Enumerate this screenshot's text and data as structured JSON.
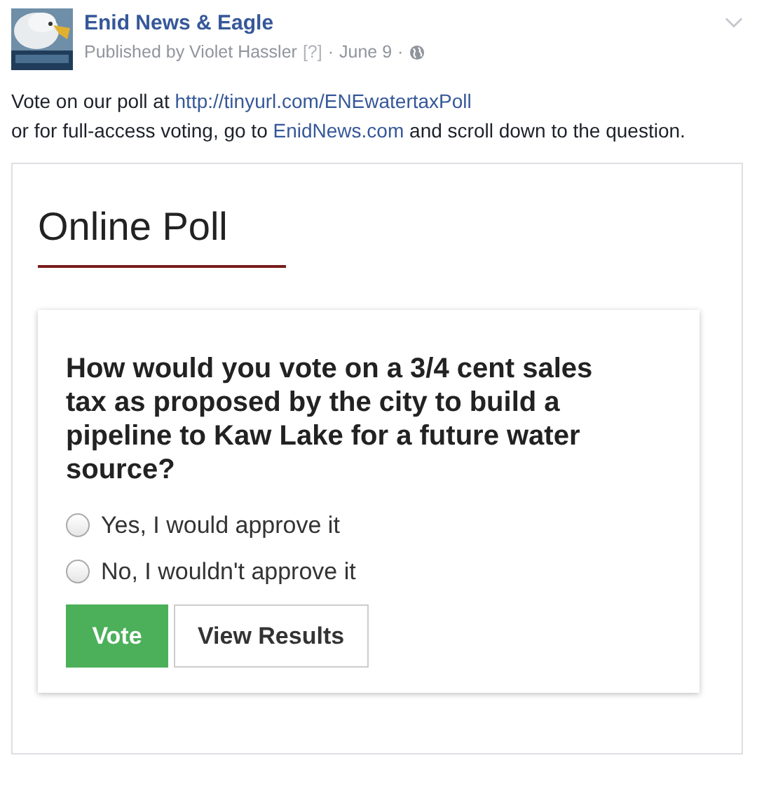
{
  "post": {
    "page_name": "Enid News & Eagle",
    "published_by": "Published by Violet Hassler",
    "help_mark": "[?]",
    "separator_1": "·",
    "date": "June 9",
    "separator_2": "·",
    "body_lines": [
      [
        {
          "kind": "text",
          "text": "Vote on our poll at "
        },
        {
          "kind": "link",
          "text": "http://tinyurl.com/ENEwatertaxPoll"
        }
      ],
      [
        {
          "kind": "text",
          "text": "or for full-access voting, go to "
        },
        {
          "kind": "link",
          "text": "EnidNews.com"
        },
        {
          "kind": "text",
          "text": " and scroll down to the question."
        }
      ]
    ]
  },
  "poll": {
    "heading": "Online Poll",
    "question": "How would you vote on a 3/4 cent sales tax as proposed by the city to build a pipeline to Kaw Lake for a future water source?",
    "options": [
      {
        "label": "Yes, I would approve it",
        "selected": false
      },
      {
        "label": "No, I wouldn't approve it",
        "selected": false
      }
    ],
    "buttons": [
      {
        "kind": "primary",
        "label": "Vote"
      },
      {
        "kind": "secondary",
        "label": "View Results"
      }
    ]
  }
}
